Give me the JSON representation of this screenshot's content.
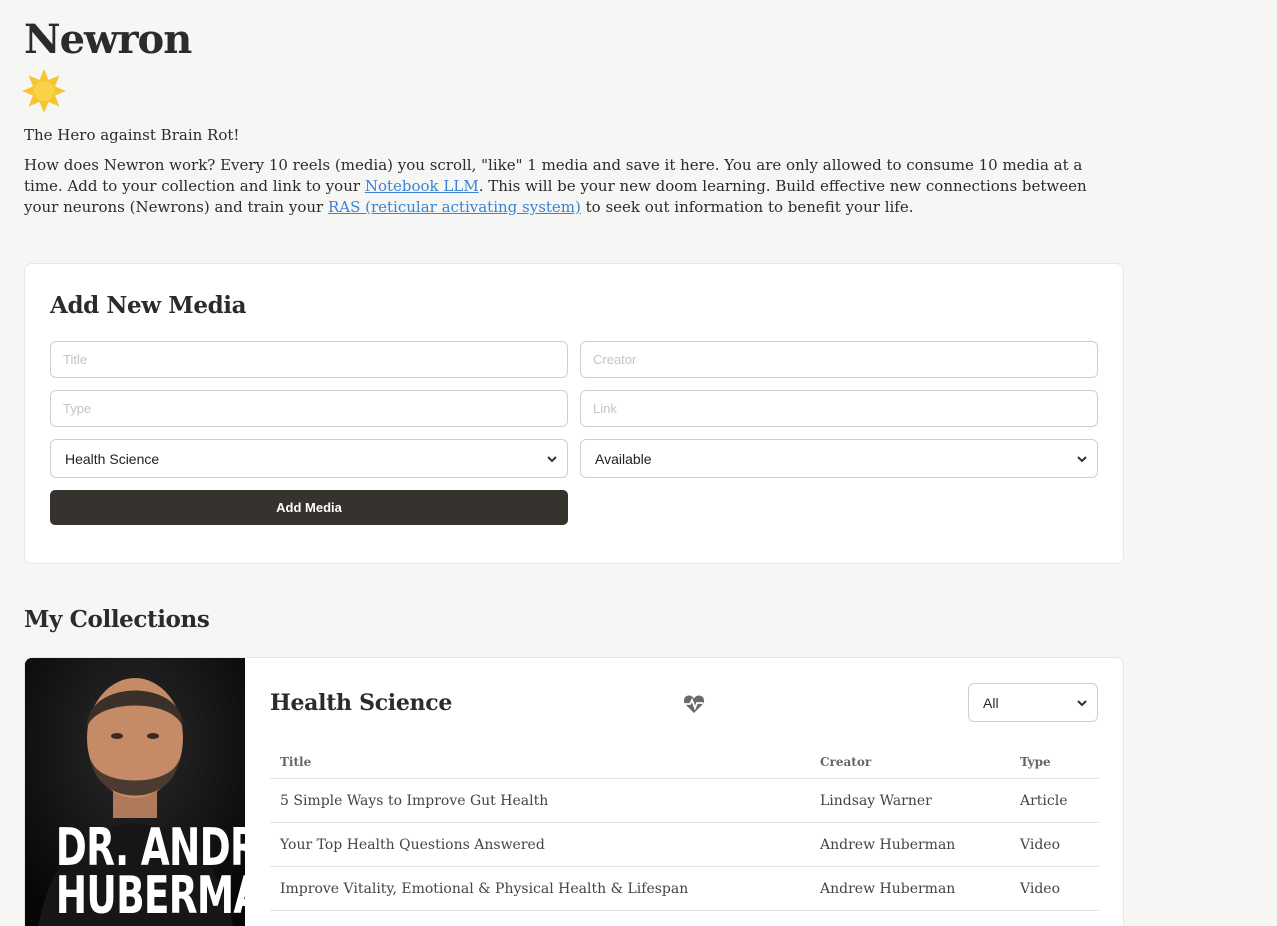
{
  "app": {
    "title": "Newron",
    "icon": "star-icon",
    "tagline": "The Hero against Brain Rot!",
    "intro": {
      "part1": "How does Newron work? Every 10 reels (media) you scroll, \"like\" 1 media and save it here. You are only allowed to consume 10 media at a time. Add to your collection and link to your ",
      "link1": "Notebook LLM",
      "part2": ". This will be your new doom learning. Build effective new connections between your neurons (Newrons) and train your ",
      "link2": "RAS (reticular activating system)",
      "part3": " to seek out information to benefit your life."
    }
  },
  "add_media": {
    "heading": "Add New Media",
    "title_placeholder": "Title",
    "creator_placeholder": "Creator",
    "type_placeholder": "Type",
    "link_placeholder": "Link",
    "category_value": "Health Science",
    "status_value": "Available",
    "submit_label": "Add Media"
  },
  "collections": {
    "heading": "My Collections",
    "items": [
      {
        "cover_line1": "DR. ANDREW",
        "cover_line2": "HUBERMAN",
        "title": "Health Science",
        "icon": "heartbeat-icon",
        "filter_value": "All",
        "columns": [
          "Title",
          "Creator",
          "Type"
        ],
        "rows": [
          {
            "title": "5 Simple Ways to Improve Gut Health",
            "creator": "Lindsay Warner",
            "type": "Article"
          },
          {
            "title": "Your Top Health Questions Answered",
            "creator": "Andrew Huberman",
            "type": "Video"
          },
          {
            "title": "Improve Vitality, Emotional & Physical Health & Lifespan",
            "creator": "Andrew Huberman",
            "type": "Video"
          }
        ]
      }
    ]
  },
  "colors": {
    "background": "#f6f6f4",
    "button": "#36332e",
    "link": "#3a83d6",
    "star": "#f7c531"
  }
}
